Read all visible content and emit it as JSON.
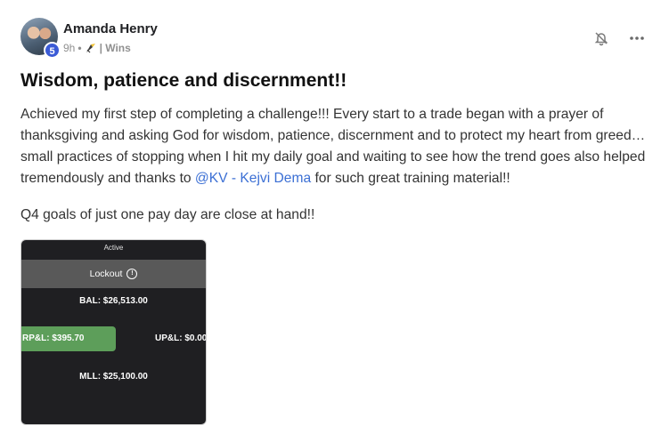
{
  "post": {
    "author": "Amanda Henry",
    "level": "5",
    "time": "9h",
    "separator": "•",
    "category": "| Wins",
    "title": "Wisdom, patience and discernment!!",
    "paragraph1_before": "Achieved my first step of completing a challenge!!! Every start to a trade began with a prayer of thanksgiving and asking God for wisdom, patience, discernment and to protect my heart from greed…small practices of stopping when I hit my daily goal and waiting to see how the trend goes also helped tremendously and thanks to ",
    "mention": "@KV - Kejvi Dema",
    "paragraph1_after": " for such great training material!!",
    "paragraph2": "Q4 goals of just one pay day are close at hand!!"
  },
  "attachment": {
    "active_label": "Active",
    "lockout_label": "Lockout",
    "info_glyph": "!",
    "bal": "BAL: $26,513.00",
    "rpl": "RP&L: $395.70",
    "upl": "UP&L: $0.00",
    "mll": "MLL: $25,100.00"
  },
  "icons": {
    "bell": "bell-slash-icon",
    "more": "more-horizontal-icon",
    "category": "rocket-chevrons-icon"
  },
  "colors": {
    "mention": "#3b6fd4",
    "level_badge": "#3b5bd6",
    "rpl_bg": "#5d9e5a",
    "lockout_bg": "#595959",
    "panel_bg": "#1f1f22"
  }
}
